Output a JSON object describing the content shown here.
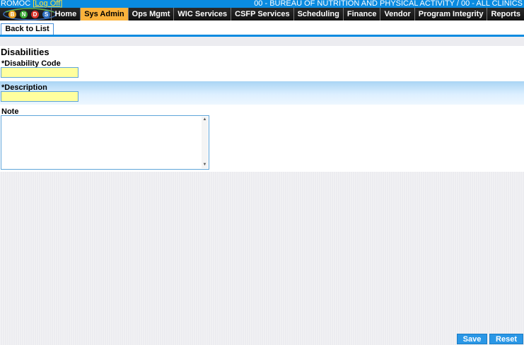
{
  "header": {
    "user": "ROMOC",
    "logoff_label": "Log Off",
    "clinic": "00 - BUREAU OF NUTRITION AND PHYSICAL ACTIVITY / 00 - ALL CLINICS"
  },
  "logo": {
    "letters": [
      "B",
      "N",
      "D",
      "S"
    ]
  },
  "nav": {
    "tabs": [
      "Home",
      "Sys Admin",
      "Ops Mgmt",
      "WIC Services",
      "CSFP Services",
      "Scheduling",
      "Finance",
      "Vendor",
      "Program Integrity",
      "Reports"
    ],
    "active": "Sys Admin"
  },
  "toolbar": {
    "back_label": "Back to List"
  },
  "form": {
    "title": "Disabilities",
    "code_label": "*Disability Code",
    "code_value": "",
    "description_label": "*Description",
    "description_value": "",
    "note_label": "Note",
    "note_value": ""
  },
  "actions": {
    "save_label": "Save",
    "reset_label": "Reset"
  },
  "colors": {
    "primary": "#0a8be0",
    "active_tab": "#fbb33c",
    "required_field": "#ffff9e",
    "button": "#2a97e6"
  }
}
